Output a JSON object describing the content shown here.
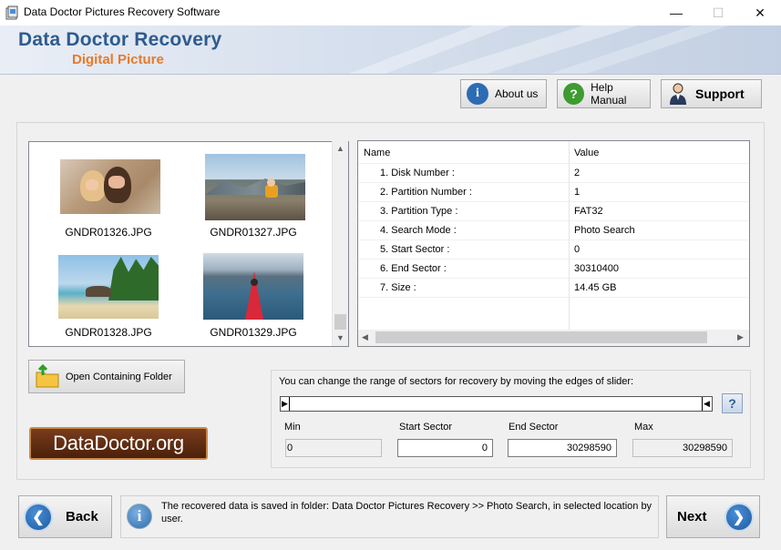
{
  "window": {
    "title": "Data Doctor Pictures Recovery Software",
    "minimize": "—",
    "maximize": "☐",
    "close": "✕"
  },
  "banner": {
    "title": "Data Doctor Recovery",
    "subtitle": "Digital Picture"
  },
  "toolbar": {
    "about": "About us",
    "help": "Help Manual",
    "support": "Support"
  },
  "thumbnails": [
    {
      "name": "GNDR01326.JPG"
    },
    {
      "name": "GNDR01327.JPG"
    },
    {
      "name": "GNDR01328.JPG"
    },
    {
      "name": "GNDR01329.JPG"
    }
  ],
  "properties": {
    "header_name": "Name",
    "header_value": "Value",
    "rows": [
      {
        "name": "1. Disk Number :",
        "value": "2"
      },
      {
        "name": "2. Partition Number :",
        "value": "1"
      },
      {
        "name": "3. Partition Type :",
        "value": "FAT32"
      },
      {
        "name": "4. Search Mode :",
        "value": "Photo Search"
      },
      {
        "name": "5. Start Sector :",
        "value": "0"
      },
      {
        "name": "6. End Sector :",
        "value": "30310400"
      },
      {
        "name": "7. Size :",
        "value": "14.45 GB"
      }
    ]
  },
  "open_folder": "Open Containing Folder",
  "logo": "DataDoctor.org",
  "slider": {
    "caption": "You can change the range of sectors for recovery by moving the edges of slider:",
    "help": "?",
    "min_label": "Min",
    "start_label": "Start Sector",
    "end_label": "End Sector",
    "max_label": "Max",
    "min_value": "0",
    "start_value": "0",
    "end_value": "30298590",
    "max_value": "30298590"
  },
  "footer": {
    "back": "Back",
    "next": "Next",
    "info": "The recovered data is saved in folder: Data Doctor Pictures Recovery  >> Photo Search, in selected location by user."
  }
}
